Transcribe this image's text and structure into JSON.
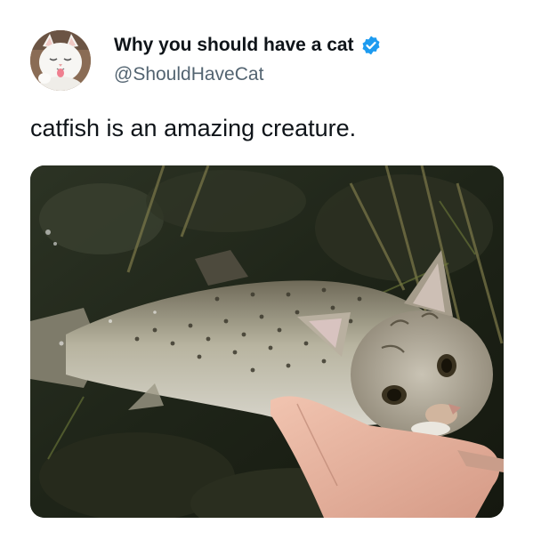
{
  "tweet": {
    "author": {
      "display_name": "Why you should have a cat",
      "handle": "@ShouldHaveCat",
      "verified": true,
      "avatar_icon": "white-cat-avatar"
    },
    "text": "catfish is an amazing creature.",
    "media": {
      "icon": "photo-cat-headed-fish",
      "type": "photo"
    }
  },
  "colors": {
    "verified_blue": "#1d9bf0",
    "text_primary": "#0f1419",
    "text_secondary": "#536471",
    "background": "#ffffff"
  }
}
